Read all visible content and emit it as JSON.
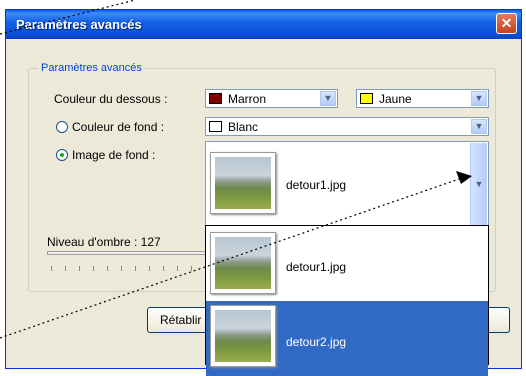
{
  "window": {
    "title": "Paramètres avancés",
    "close_glyph": "✕"
  },
  "group": {
    "legend": "Paramètres avancés"
  },
  "rows": {
    "couleur_dessous_label": "Couleur du dessous :",
    "couleur_fond_label": "Couleur de fond :",
    "image_fond_label": "Image de fond :"
  },
  "combos": {
    "dessous_1": {
      "value": "Marron",
      "color": "#800000"
    },
    "dessous_2": {
      "value": "Jaune",
      "color": "#ffff00"
    },
    "fond": {
      "value": "Blanc",
      "color": "#ffffff"
    },
    "image": {
      "value": "detour1.jpg"
    }
  },
  "radios": {
    "couleur_fond_selected": false,
    "image_fond_selected": true
  },
  "dropdown": {
    "items": [
      {
        "label": "detour1.jpg",
        "selected": false
      },
      {
        "label": "detour2.jpg",
        "selected": true
      }
    ]
  },
  "shadow": {
    "label": "Niveau d'ombre : 127",
    "value": 127
  },
  "buttons": {
    "reset_label": "Rétablir"
  },
  "icons": {
    "dropdown_arrow": "chevron-down-icon",
    "close": "close-icon"
  }
}
